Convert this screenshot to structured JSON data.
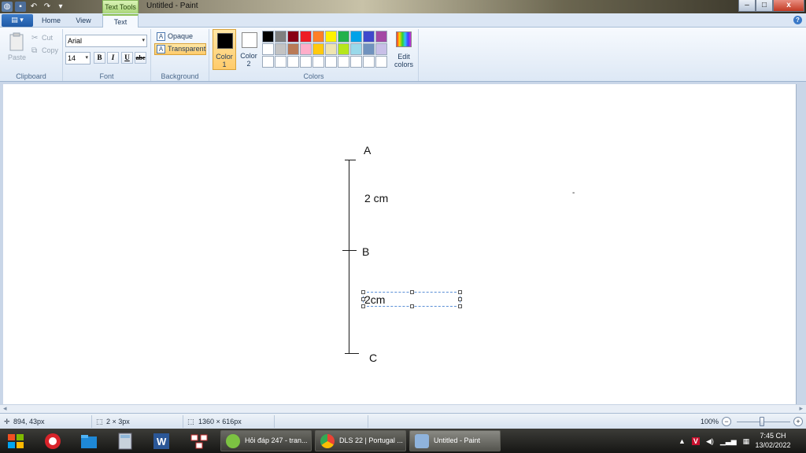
{
  "window": {
    "title": "Untitled - Paint",
    "context_tab": "Text Tools"
  },
  "window_controls": {
    "minimize": "–",
    "maximize": "□",
    "close": "x"
  },
  "tabs": {
    "home": "Home",
    "view": "View",
    "text": "Text"
  },
  "ribbon": {
    "clipboard": {
      "paste": "Paste",
      "cut": "Cut",
      "copy": "Copy",
      "label": "Clipboard"
    },
    "font": {
      "name": "Arial",
      "size": "14",
      "bold": "B",
      "italic": "I",
      "underline": "U",
      "strike": "abc",
      "label": "Font"
    },
    "background": {
      "opaque": "Opaque",
      "transparent": "Transparent",
      "label": "Background"
    },
    "colors": {
      "color1_line1": "Color",
      "color1_line2": "1",
      "color2_line1": "Color",
      "color2_line2": "2",
      "edit_line1": "Edit",
      "edit_line2": "colors",
      "label": "Colors",
      "color1_value": "#000000",
      "color2_value": "#ffffff",
      "palette_row1": [
        "#000000",
        "#7f7f7f",
        "#880015",
        "#ed1c24",
        "#ff7f27",
        "#fff200",
        "#22b14c",
        "#00a2e8",
        "#3f48cc",
        "#a349a4"
      ],
      "palette_row2": [
        "#ffffff",
        "#c3c3c3",
        "#b97a57",
        "#ffaec9",
        "#ffc90e",
        "#efe4b0",
        "#b5e61d",
        "#99d9ea",
        "#7092be",
        "#c8bfe7"
      ],
      "palette_row3": [
        "#ffffff",
        "#ffffff",
        "#ffffff",
        "#ffffff",
        "#ffffff",
        "#ffffff",
        "#ffffff",
        "#ffffff",
        "#ffffff",
        "#ffffff"
      ]
    }
  },
  "canvas": {
    "label_a": "A",
    "label_b": "B",
    "label_c": "C",
    "seg1_text": "2 cm",
    "seg2_text": "2cm",
    "stray_mark": "-"
  },
  "status": {
    "cursor_pos": "894, 43px",
    "selection_size": "2 × 3px",
    "image_size": "1360 × 616px",
    "zoom": "100%"
  },
  "taskbar": {
    "task1": "Hỏi đáp 247 - tran...",
    "task2": "DLS 22 | Portugal ...",
    "task3": "Untitled - Paint",
    "time": "7:45 CH",
    "date": "13/02/2022"
  }
}
